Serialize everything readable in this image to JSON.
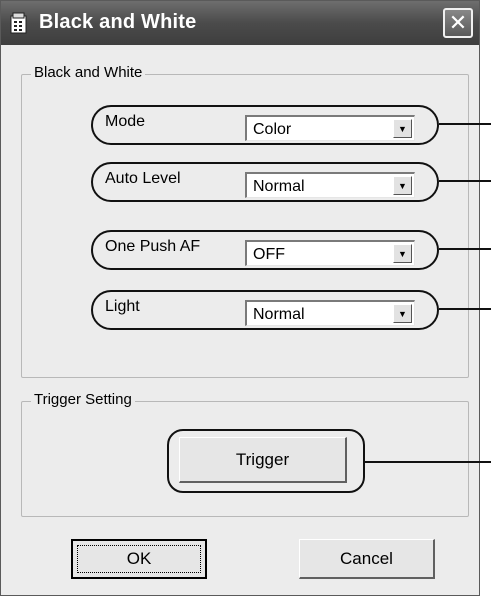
{
  "window": {
    "title": "Black and White",
    "close_symbol": "✕"
  },
  "group_main": {
    "label": "Black and White",
    "rows": [
      {
        "label": "Mode",
        "value": "Color"
      },
      {
        "label": "Auto Level",
        "value": "Normal"
      },
      {
        "label": "One Push AF",
        "value": "OFF"
      },
      {
        "label": "Light",
        "value": "Normal"
      }
    ]
  },
  "group_trigger": {
    "label": "Trigger Setting",
    "button_label": "Trigger"
  },
  "footer": {
    "ok_label": "OK",
    "cancel_label": "Cancel"
  },
  "icons": {
    "title": "dialog-app-icon",
    "close": "close-icon",
    "dropdown": "chevron-down-icon"
  }
}
